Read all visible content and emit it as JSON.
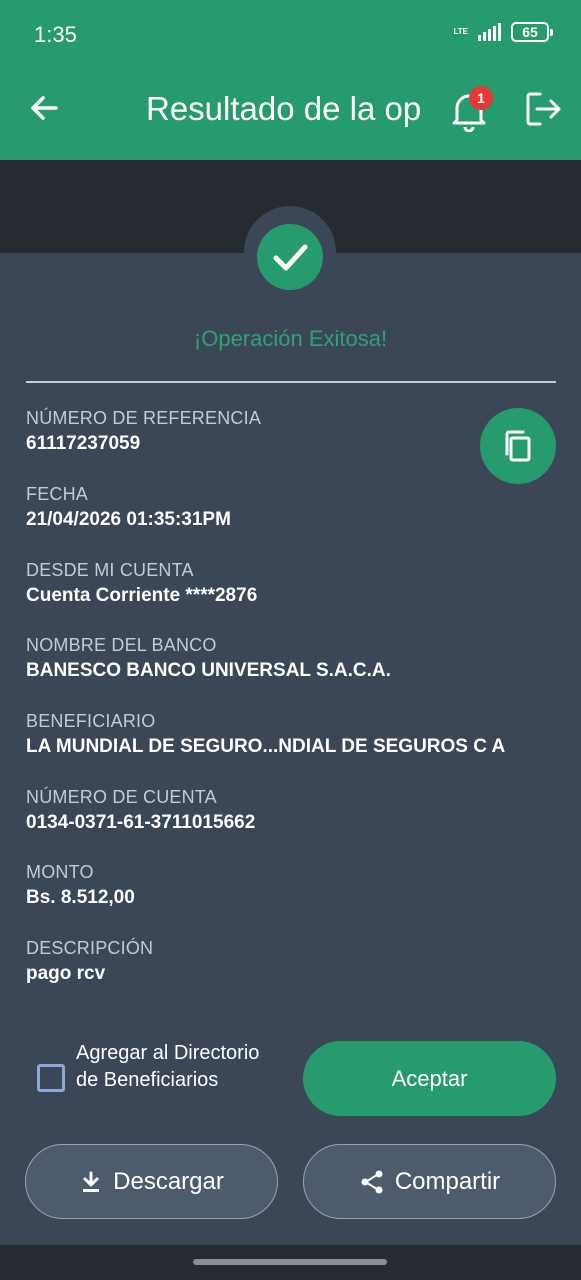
{
  "status_bar": {
    "time": "1:35",
    "network": "LTE",
    "battery": "65"
  },
  "header": {
    "title": "Resultado de la op",
    "notification_count": "1"
  },
  "result": {
    "message": "¡Operación Exitosa!"
  },
  "fields": [
    {
      "label": "NÚMERO DE REFERENCIA",
      "value": "61117237059"
    },
    {
      "label": "FECHA",
      "value": "21/04/2026 01:35:31PM"
    },
    {
      "label": "DESDE MI CUENTA",
      "value": "Cuenta Corriente ****2876"
    },
    {
      "label": "NOMBRE DEL BANCO",
      "value": "BANESCO BANCO UNIVERSAL S.A.C.A."
    },
    {
      "label": "BENEFICIARIO",
      "value": "LA MUNDIAL DE SEGURO...NDIAL DE SEGUROS C A"
    },
    {
      "label": "NÚMERO DE CUENTA",
      "value": "0134-0371-61-3711015662"
    },
    {
      "label": "MONTO",
      "value": "Bs. 8.512,00"
    },
    {
      "label": "DESCRIPCIÓN",
      "value": "pago rcv"
    }
  ],
  "add_directory": {
    "label": "Agregar al Directorio de Beneficiarios",
    "checked": false
  },
  "buttons": {
    "accept": "Aceptar",
    "download": "Descargar",
    "share": "Compartir"
  },
  "colors": {
    "brand_green": "#269b6e",
    "background": "#3b4657",
    "dark_band": "#262b32",
    "badge_red": "#e53935"
  }
}
